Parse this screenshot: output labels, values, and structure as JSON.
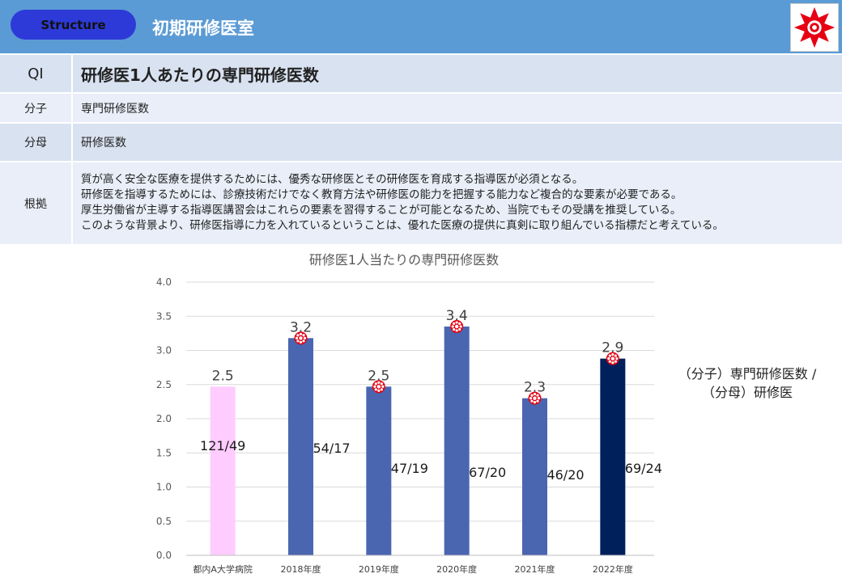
{
  "header": {
    "badge": "Structure",
    "title": "初期研修医室"
  },
  "table": {
    "qi": {
      "key": "QI",
      "value": "研修医1人あたりの専門研修医数"
    },
    "numerator": {
      "key": "分子",
      "value": "専門研修医数"
    },
    "denominator": {
      "key": "分母",
      "value": "研修医数"
    },
    "basis": {
      "key": "根拠",
      "lines": [
        "質が高く安全な医療を提供するためには、優秀な研修医とその研修医を育成する指導医が必須となる。",
        "研修医を指導するためには、診療技術だけでなく教育方法や研修医の能力を把握する能力など複合的な要素が必要である。",
        "厚生労働省が主導する指導医講習会はこれらの要素を習得することが可能となるため、当院でもその受講を推奨している。",
        "このような背景より、研修医指導に力を入れているということは、優れた医療の提供に真剣に取り組んでいる指標だと考えている。"
      ]
    }
  },
  "chart_note": {
    "line1": "（分子）専門研修医数 /",
    "line2": "（分母）研修医"
  },
  "chart_data": {
    "type": "bar",
    "title": "研修医1人当たりの専門研修医数",
    "categories": [
      "都内A大学病院",
      "2018年度",
      "2019年度",
      "2020年度",
      "2021年度",
      "2022年度"
    ],
    "values": [
      2.5,
      3.2,
      2.5,
      3.4,
      2.3,
      2.9
    ],
    "value_labels": [
      "2.5",
      "3.2",
      "2.5",
      "3.4",
      "2.3",
      "2.9"
    ],
    "bar_values": [
      2.47,
      3.18,
      2.47,
      3.35,
      2.3,
      2.88
    ],
    "fractions": [
      "121/49",
      "54/17",
      "47/19",
      "67/20",
      "46/20",
      "69/24"
    ],
    "colors": [
      "#ffccff",
      "#4a66b0",
      "#4a66b0",
      "#4a66b0",
      "#4a66b0",
      "#00205b"
    ],
    "ylim": [
      0,
      4.0
    ],
    "yticks": [
      "0.0",
      "0.5",
      "1.0",
      "1.5",
      "2.0",
      "2.5",
      "3.0",
      "3.5",
      "4.0"
    ],
    "grid": true,
    "marker_icon": "hospital-emblem-icon",
    "xlabel": "",
    "ylabel": ""
  }
}
